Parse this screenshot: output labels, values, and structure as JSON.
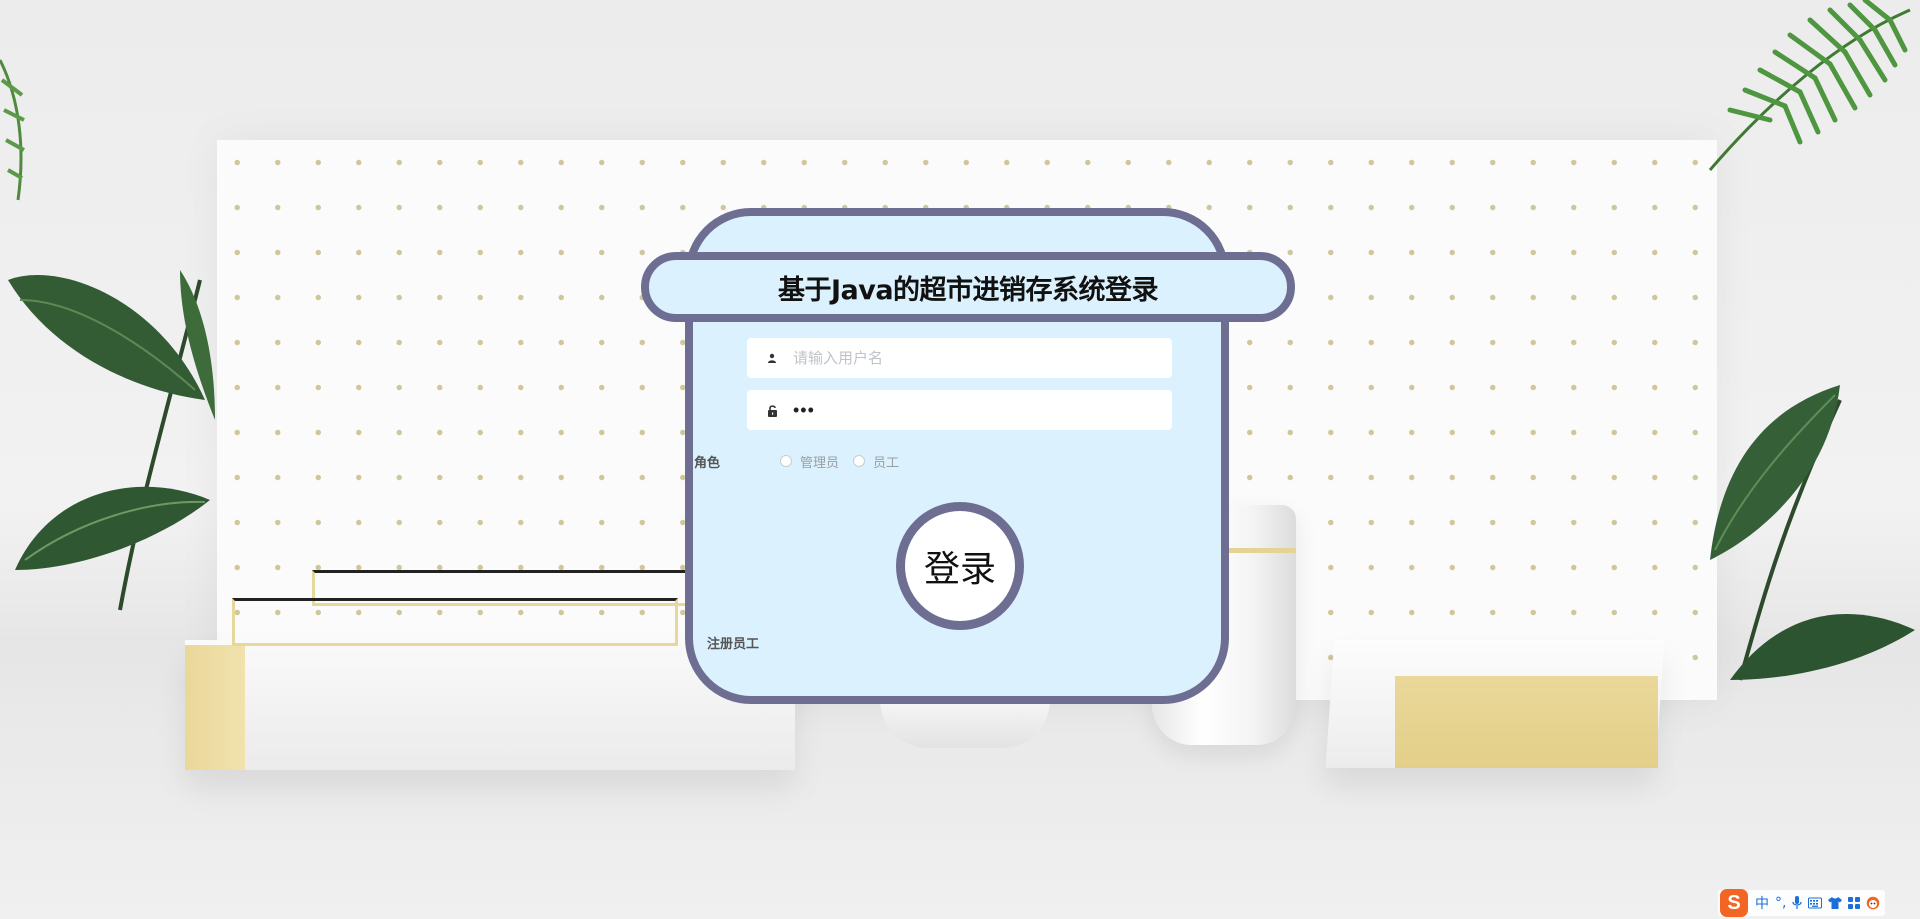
{
  "window": {
    "title": "基于Java的超市进销存系统登录"
  },
  "login": {
    "title": "基于Java的超市进销存系统登录",
    "username": {
      "placeholder": "请输入用户名",
      "value": "",
      "icon": "user-icon"
    },
    "password": {
      "value": "•••",
      "icon": "lock-icon"
    },
    "role": {
      "label": "角色",
      "options": [
        {
          "label": "管理员",
          "checked": false
        },
        {
          "label": "员工",
          "checked": false
        }
      ]
    },
    "submit_label": "登录",
    "register_label": "注册员工"
  },
  "ime_tray": {
    "logo": "S",
    "items": [
      "中",
      "°,",
      "mic-icon",
      "keyboard-icon",
      "shirt-icon",
      "grid-icon",
      "face-icon"
    ]
  },
  "colors": {
    "card_background": "#dbf1fd",
    "card_border": "#6e6e92",
    "ime_brand": "#f26522",
    "ime_accent": "#1a6fd8"
  }
}
